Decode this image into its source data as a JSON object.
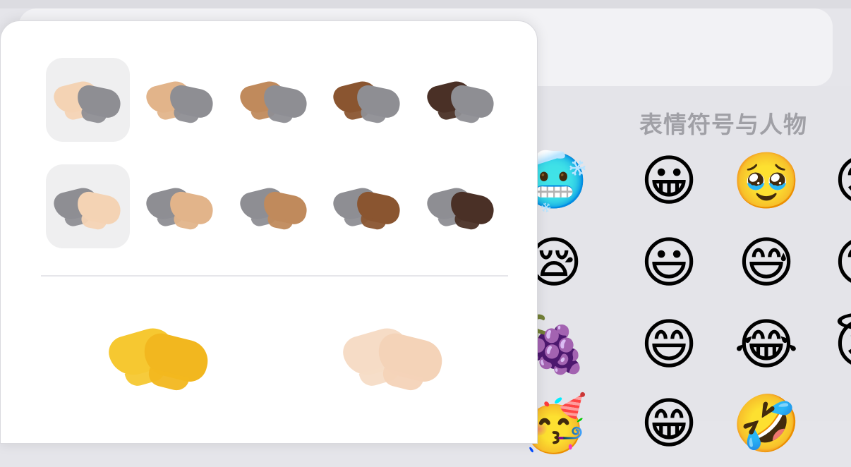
{
  "keyboard": {
    "category_title": "表情符号与人物",
    "emojis": [
      {
        "id": "freezing-face",
        "glyph": "🥶"
      },
      {
        "id": "grinning-face",
        "glyph": "😀"
      },
      {
        "id": "pleading-face",
        "glyph": "🥹"
      },
      {
        "id": "partial-face-1",
        "glyph": "😊"
      },
      {
        "id": "sleepy-face",
        "glyph": "😪"
      },
      {
        "id": "grinning-big-eyes",
        "glyph": "😃"
      },
      {
        "id": "grinning-sweat",
        "glyph": "😅"
      },
      {
        "id": "partial-face-2",
        "glyph": "😙"
      },
      {
        "id": "grapes",
        "glyph": "🍇"
      },
      {
        "id": "grinning-smiling-eyes",
        "glyph": "😄"
      },
      {
        "id": "tears-of-joy",
        "glyph": "😂"
      },
      {
        "id": "halo-face",
        "glyph": "😇"
      },
      {
        "id": "party-face",
        "glyph": "🥳"
      },
      {
        "id": "partial-bottom-1",
        "glyph": "😁"
      },
      {
        "id": "partial-bottom-2",
        "glyph": "🤣"
      }
    ]
  },
  "popover": {
    "tone_rows": [
      {
        "row": "left-hand",
        "tones": [
          {
            "tone": "light",
            "color": "#f4d3b4",
            "selected": true
          },
          {
            "tone": "medium-light",
            "color": "#e2b48a",
            "selected": false
          },
          {
            "tone": "medium",
            "color": "#c08a5c",
            "selected": false
          },
          {
            "tone": "medium-dark",
            "color": "#8a5530",
            "selected": false
          },
          {
            "tone": "dark",
            "color": "#4a3026",
            "selected": false
          }
        ]
      },
      {
        "row": "right-hand",
        "tones": [
          {
            "tone": "light",
            "color": "#f4d3b4",
            "selected": true
          },
          {
            "tone": "medium-light",
            "color": "#e2b48a",
            "selected": false
          },
          {
            "tone": "medium",
            "color": "#c08a5c",
            "selected": false
          },
          {
            "tone": "medium-dark",
            "color": "#8a5530",
            "selected": false
          },
          {
            "tone": "dark",
            "color": "#4a3026",
            "selected": false
          }
        ]
      }
    ],
    "placeholder_hand_color": "#8e8e93",
    "options": [
      {
        "id": "default-yellow",
        "color_left": "#f6c831",
        "color_right": "#f2b71f"
      },
      {
        "id": "light-light",
        "color_left": "#f6dcc6",
        "color_right": "#f4d3b8"
      }
    ]
  }
}
